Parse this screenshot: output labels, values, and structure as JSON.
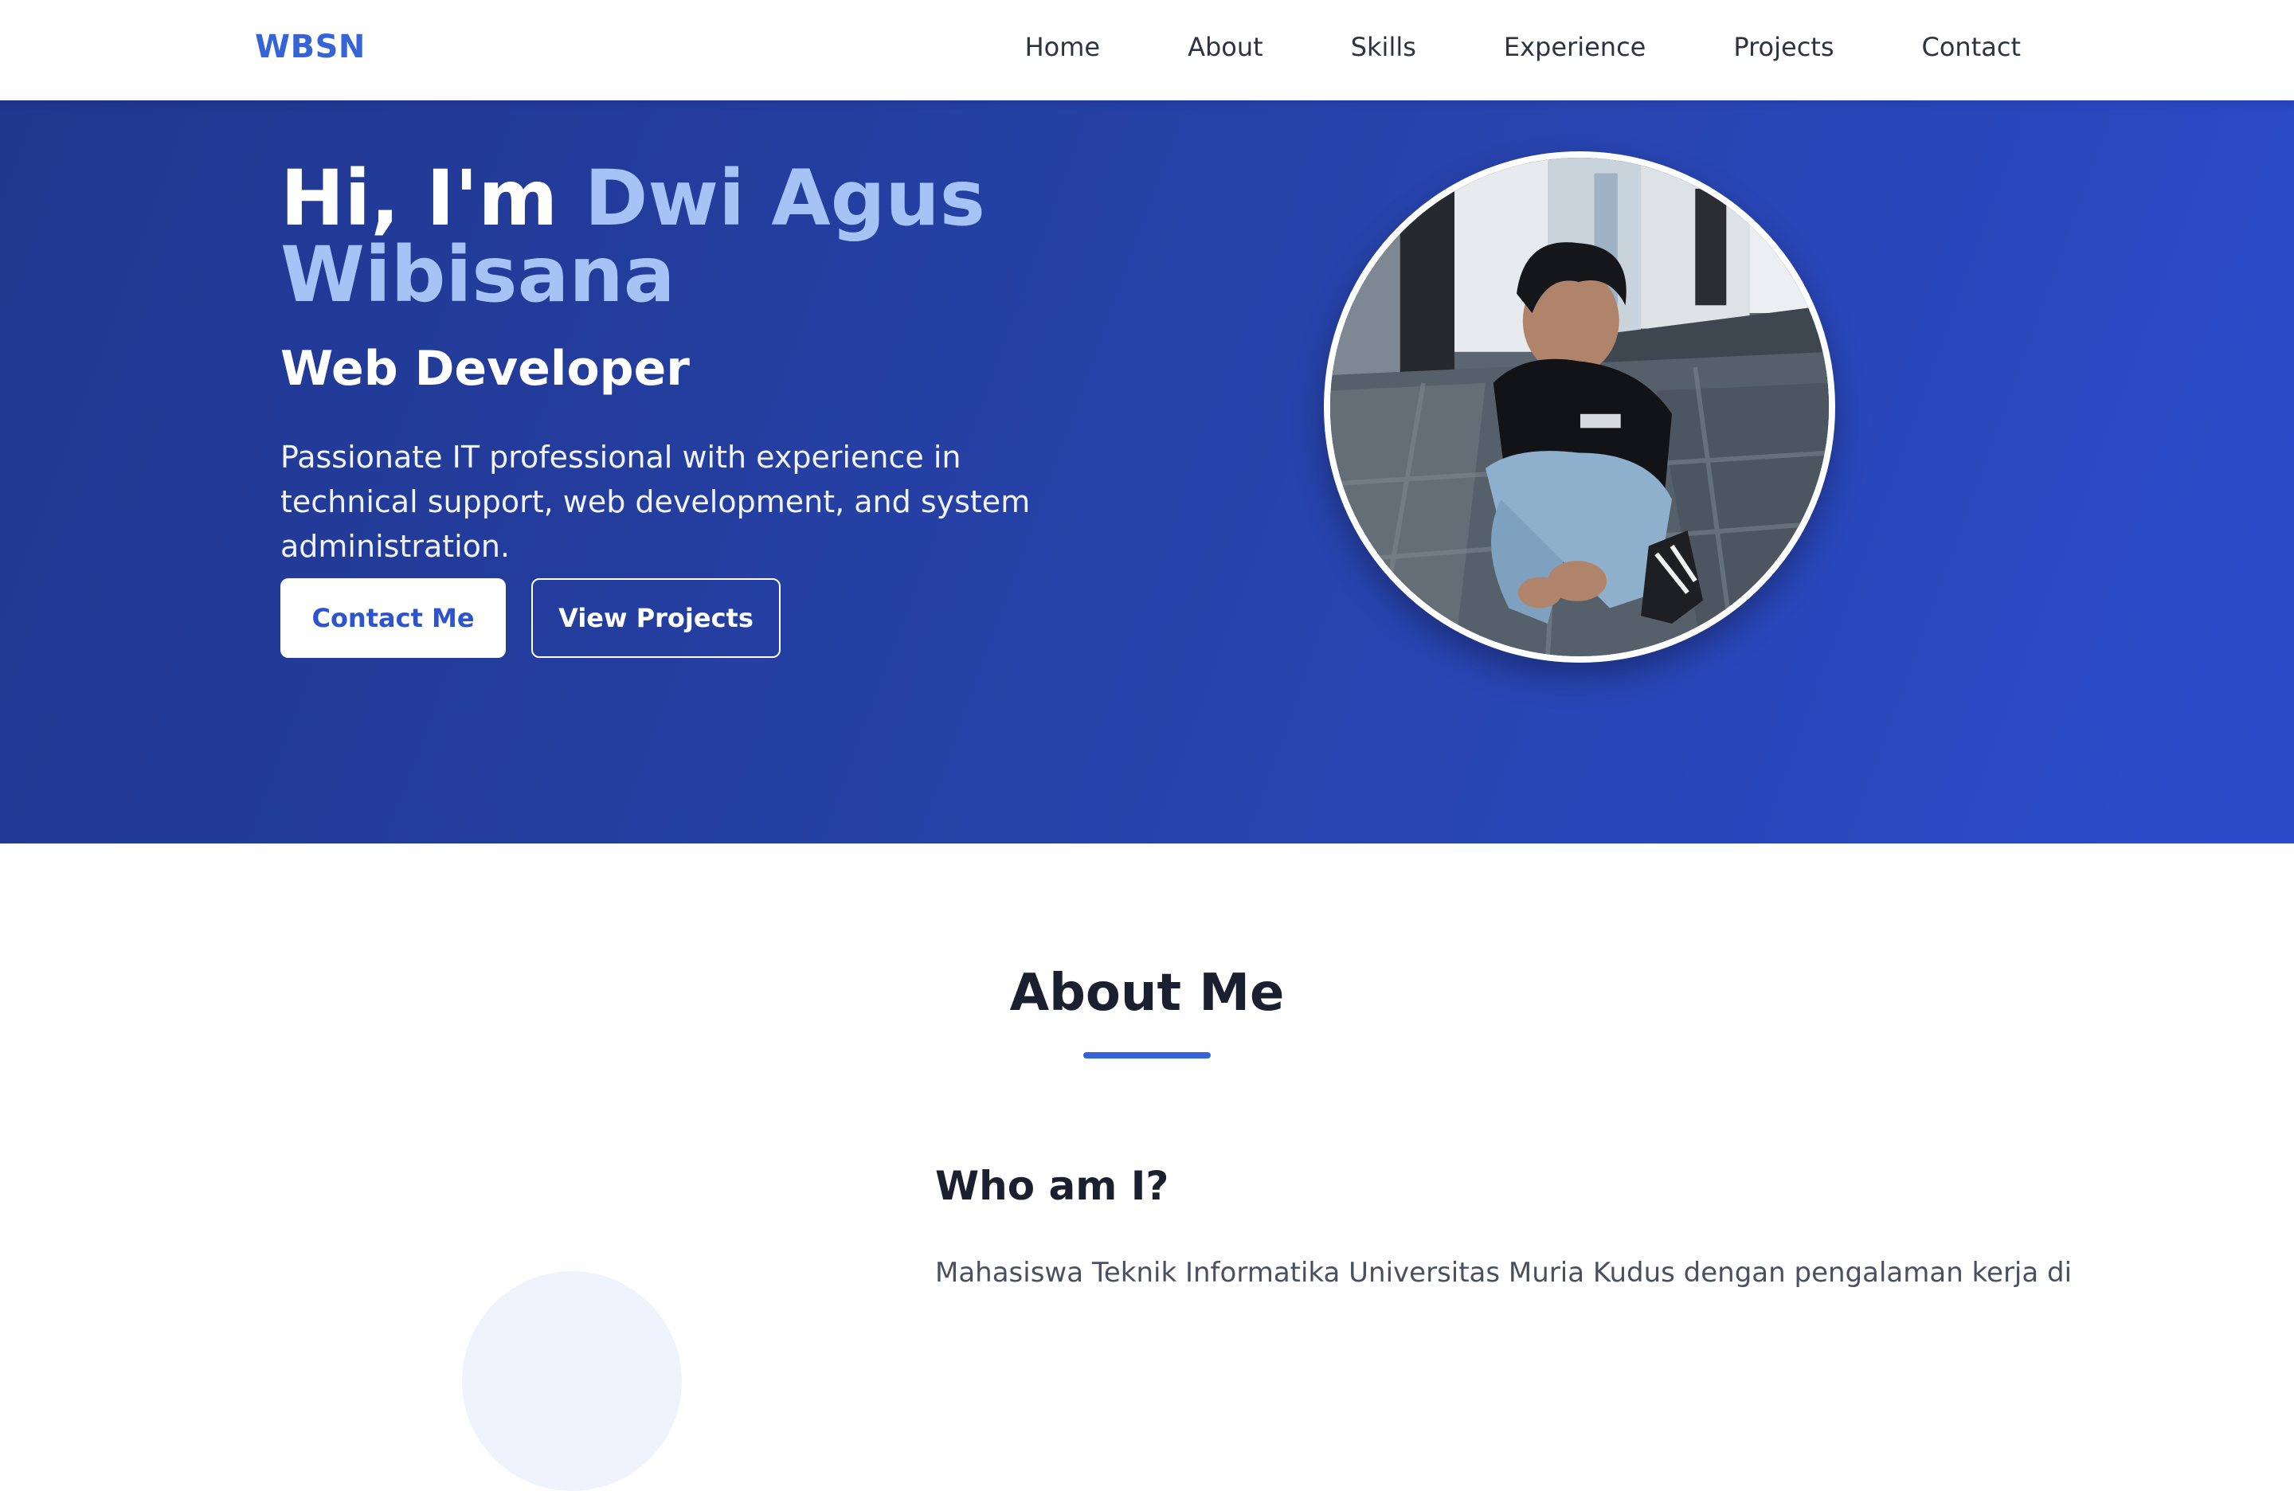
{
  "nav": {
    "logo": "WBSN",
    "links": [
      "Home",
      "About",
      "Skills",
      "Experience",
      "Projects",
      "Contact"
    ]
  },
  "hero": {
    "greeting": "Hi, I'm",
    "name_line1": "Dwi Agus",
    "name_line2": "Wibisana",
    "role": "Web Developer",
    "description": "Passionate IT professional with experience in technical support, web development, and system administration.",
    "contact_button": "Contact Me",
    "projects_button": "View Projects",
    "gradient_start": "#20378f",
    "gradient_end": "#2b4bcb",
    "accent_color": "#a5c3f5"
  },
  "about": {
    "heading": "About Me",
    "subheading": "Who am I?",
    "text": "Mahasiswa Teknik Informatika Universitas Muria Kudus dengan pengalaman kerja di",
    "accent_color": "#3563d8"
  }
}
